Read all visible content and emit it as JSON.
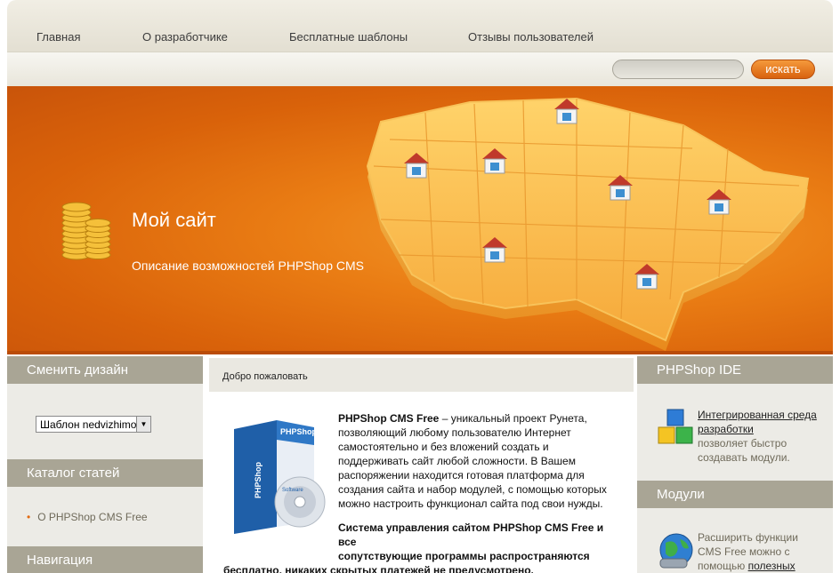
{
  "nav": {
    "items": [
      {
        "label": "Главная"
      },
      {
        "label": "О разработчике"
      },
      {
        "label": "Бесплатные шаблоны"
      },
      {
        "label": "Отзывы пользователей"
      }
    ]
  },
  "search": {
    "placeholder": "",
    "button_label": "искать"
  },
  "banner": {
    "title": "Мой сайт",
    "description": "Описание возможностей PHPShop CMS"
  },
  "left": {
    "design_title": "Сменить дизайн",
    "design_select_value": "Шаблон nedvizhimost",
    "catalog_title": "Каталог статей",
    "catalog_items": [
      {
        "label": "О PHPShop CMS Free"
      }
    ],
    "nav_title": "Навигация"
  },
  "main": {
    "header": "Добро пожаловать",
    "intro_bold": "PHPShop CMS Free",
    "intro_rest": " – уникальный проект Рунета, позволяющий любому пользователю Интернет самостоятельно и без вложений создать и поддерживать сайт любой сложности. В Вашем распоряжении находится готовая платформа для создания сайта и набор модулей, с помощью которых можно настроить функционал сайта под свои нужды.",
    "notice_line1": "Система управления сайтом PHPShop CMS Free и все",
    "notice_line2": "сопутствующие программы распространяются",
    "notice_line3": "бесплатно, никаких скрытых платежей не предусмотрено.",
    "box_brand": "PHPShop",
    "box_side": "PHPShop",
    "box_disc": "Software"
  },
  "right": {
    "ide_title": "PHPShop IDE",
    "ide_link": "Интегрированная среда разработки",
    "ide_text": "позволяет быстро создавать модули.",
    "modules_title": "Модули",
    "modules_text": "Расширить функции CMS Free можно с помощью",
    "modules_link": "полезных"
  },
  "colors": {
    "accent": "#e5720f",
    "block_header": "#a9a595",
    "sidebar_bg": "#ecebe6"
  }
}
